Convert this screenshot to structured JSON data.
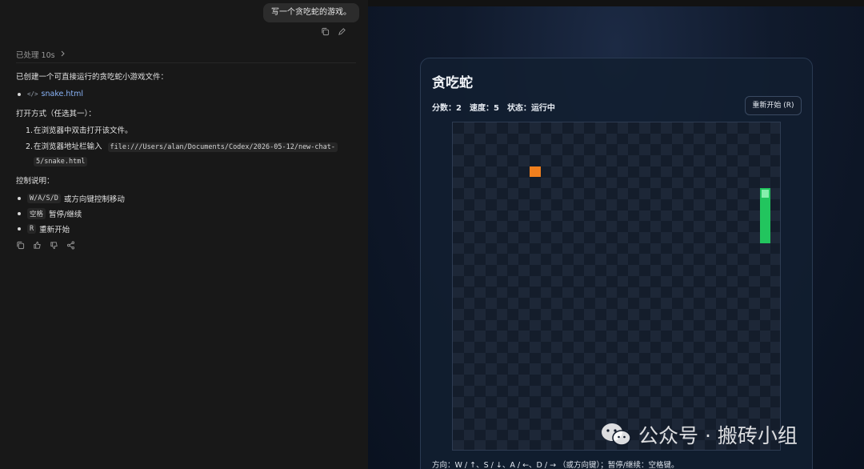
{
  "chat": {
    "user_message": "写一个贪吃蛇的游戏。",
    "processed_label": "已处理 10s",
    "intro": "已创建一个可直接运行的贪吃蛇小游戏文件：",
    "file_name": "snake.html",
    "open_heading": "打开方式（任选其一）：",
    "open_steps": [
      {
        "num": "1.",
        "text": "在浏览器中双击打开该文件。"
      },
      {
        "num": "2.",
        "text": "在浏览器地址栏输入",
        "code": "file:///Users/alan/Documents/Codex/2026-05-12/new-chat-",
        "code_cont": "5/snake.html"
      }
    ],
    "controls_heading": "控制说明：",
    "controls": [
      {
        "code": "W/A/S/D",
        "text": "或方向键控制移动"
      },
      {
        "code": "空格",
        "text": "暂停/继续"
      },
      {
        "code": "R",
        "text": "重新开始"
      }
    ],
    "icons": [
      "copy-icon",
      "edit-icon",
      "thumbs-up-icon",
      "thumbs-down-icon",
      "share-icon",
      "chevron-right-icon",
      "code-icon"
    ]
  },
  "game": {
    "title": "贪吃蛇",
    "score_label": "分数：",
    "score": "2",
    "speed_label": "速度：",
    "speed": "5",
    "status_label": "状态：",
    "status": "运行中",
    "restart_label": "重新开始 (R)",
    "help_text": "方向：W / ↑、S / ↓、A / ←、D / → （或方向键）；暂停/继续：空格键。",
    "grid_size": 30,
    "food": {
      "col": 7,
      "row": 4
    },
    "snake": [
      {
        "col": 28,
        "row": 6
      },
      {
        "col": 28,
        "row": 7
      },
      {
        "col": 28,
        "row": 8
      },
      {
        "col": 28,
        "row": 9
      },
      {
        "col": 28,
        "row": 10
      }
    ],
    "colors": {
      "food": "#f07f1e",
      "snake_body": "#22c55e",
      "snake_head": "#86efac",
      "cell_dark": "#141d2b",
      "cell_light": "#1d2737"
    }
  },
  "watermark": {
    "text": "公众号 · 搬砖小组"
  }
}
